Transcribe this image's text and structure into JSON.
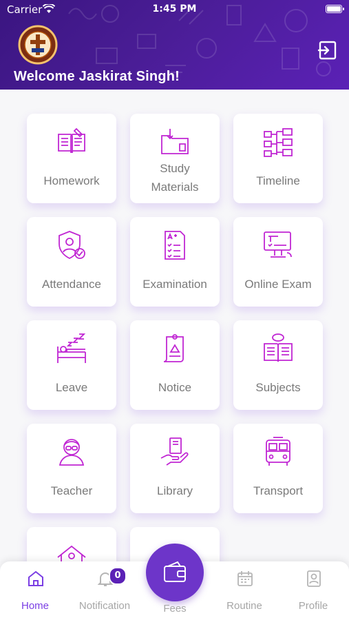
{
  "status_bar": {
    "carrier": "Carrier",
    "time": "1:45 PM"
  },
  "header": {
    "welcome": "Welcome Jaskirat Singh!",
    "logout_icon": "logout-icon",
    "logo_icon": "school-crest-icon"
  },
  "colors": {
    "primary": "#5b21b6",
    "accent": "#7b3fe4",
    "icon": "#c026d3",
    "label": "#7a7a7a"
  },
  "menu": [
    {
      "label": "Homework",
      "icon": "homework-icon"
    },
    {
      "label": "Study Materials",
      "icon": "study-materials-icon"
    },
    {
      "label": "Timeline",
      "icon": "timeline-icon"
    },
    {
      "label": "Attendance",
      "icon": "attendance-icon"
    },
    {
      "label": "Examination",
      "icon": "examination-icon"
    },
    {
      "label": "Online Exam",
      "icon": "online-exam-icon"
    },
    {
      "label": "Leave",
      "icon": "leave-icon"
    },
    {
      "label": "Notice",
      "icon": "notice-icon"
    },
    {
      "label": "Subjects",
      "icon": "subjects-icon"
    },
    {
      "label": "Teacher",
      "icon": "teacher-icon"
    },
    {
      "label": "Library",
      "icon": "library-icon"
    },
    {
      "label": "Transport",
      "icon": "transport-icon"
    }
  ],
  "bottom_nav": {
    "home": "Home",
    "notification": "Notification",
    "notification_count": "0",
    "fees": "Fees",
    "routine": "Routine",
    "profile": "Profile"
  }
}
